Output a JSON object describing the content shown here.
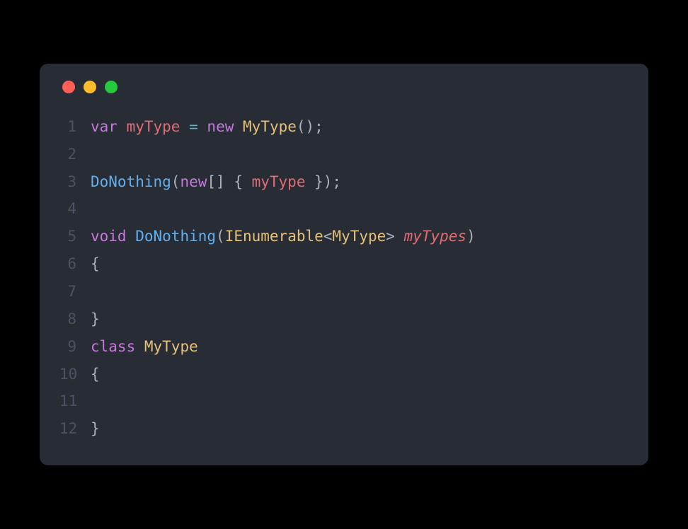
{
  "window": {
    "dots": [
      "red",
      "yellow",
      "green"
    ]
  },
  "code": {
    "lines": [
      {
        "num": "1",
        "tokens": [
          {
            "t": "var",
            "c": "kw"
          },
          {
            "t": " ",
            "c": ""
          },
          {
            "t": "myType",
            "c": "var"
          },
          {
            "t": " ",
            "c": ""
          },
          {
            "t": "=",
            "c": "op"
          },
          {
            "t": " ",
            "c": ""
          },
          {
            "t": "new",
            "c": "kw"
          },
          {
            "t": " ",
            "c": ""
          },
          {
            "t": "MyType",
            "c": "type"
          },
          {
            "t": "();",
            "c": "punct"
          }
        ]
      },
      {
        "num": "2",
        "tokens": []
      },
      {
        "num": "3",
        "tokens": [
          {
            "t": "DoNothing",
            "c": "fn"
          },
          {
            "t": "(",
            "c": "punct"
          },
          {
            "t": "new",
            "c": "kw"
          },
          {
            "t": "[] { ",
            "c": "punct"
          },
          {
            "t": "myType",
            "c": "var"
          },
          {
            "t": " });",
            "c": "punct"
          }
        ]
      },
      {
        "num": "4",
        "tokens": []
      },
      {
        "num": "5",
        "tokens": [
          {
            "t": "void",
            "c": "kw"
          },
          {
            "t": " ",
            "c": ""
          },
          {
            "t": "DoNothing",
            "c": "fn"
          },
          {
            "t": "(",
            "c": "punct"
          },
          {
            "t": "IEnumerable",
            "c": "type"
          },
          {
            "t": "<",
            "c": "punct"
          },
          {
            "t": "MyType",
            "c": "type"
          },
          {
            "t": "> ",
            "c": "punct"
          },
          {
            "t": "myTypes",
            "c": "param"
          },
          {
            "t": ")",
            "c": "punct"
          }
        ]
      },
      {
        "num": "6",
        "tokens": [
          {
            "t": "{",
            "c": "punct"
          }
        ]
      },
      {
        "num": "7",
        "tokens": []
      },
      {
        "num": "8",
        "tokens": [
          {
            "t": "}",
            "c": "punct"
          }
        ]
      },
      {
        "num": "9",
        "tokens": [
          {
            "t": "class",
            "c": "kw"
          },
          {
            "t": " ",
            "c": ""
          },
          {
            "t": "MyType",
            "c": "type"
          }
        ]
      },
      {
        "num": "10",
        "tokens": [
          {
            "t": "{",
            "c": "punct"
          }
        ]
      },
      {
        "num": "11",
        "tokens": []
      },
      {
        "num": "12",
        "tokens": [
          {
            "t": "}",
            "c": "punct"
          }
        ]
      }
    ]
  }
}
